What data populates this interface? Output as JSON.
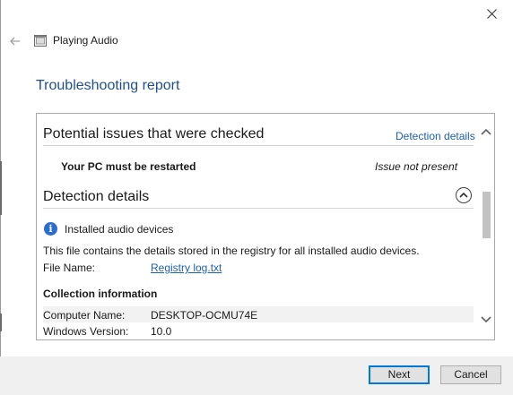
{
  "window": {
    "title": "Playing Audio"
  },
  "heading": "Troubleshooting report",
  "issues_section": {
    "title": "Potential issues that were checked",
    "details_link": "Detection details",
    "issue": {
      "name": "Your PC must be restarted",
      "status": "Issue not present"
    }
  },
  "detection_section": {
    "title": "Detection details",
    "item_title": "Installed audio devices",
    "description": "This file contains the details stored in the registry for all installed audio devices.",
    "file_label": "File Name:",
    "file_value": "Registry log.txt",
    "collection_title": "Collection information",
    "rows": [
      {
        "label": "Computer Name:",
        "value": "DESKTOP-OCMU74E"
      },
      {
        "label": "Windows Version:",
        "value": "10.0"
      }
    ]
  },
  "buttons": {
    "next": "Next",
    "cancel": "Cancel"
  },
  "colors": {
    "heading": "#1f4e96",
    "link": "#1d5fb8",
    "primary_border": "#0078d7"
  }
}
